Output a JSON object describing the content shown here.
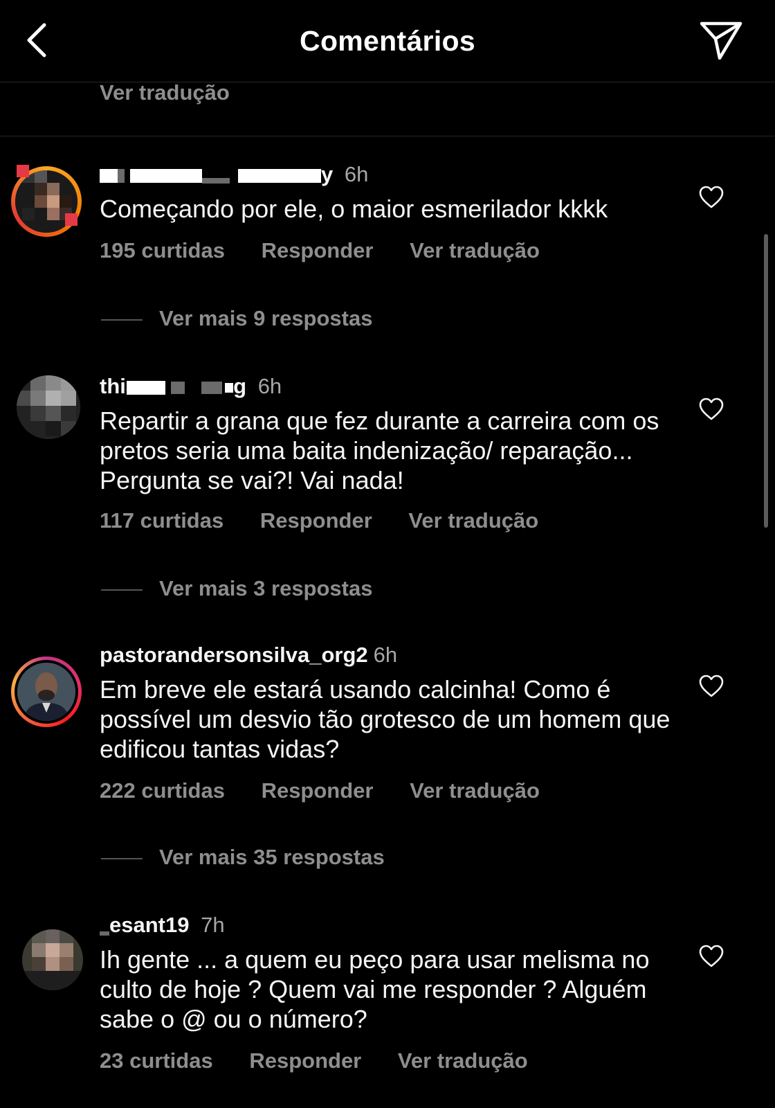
{
  "header": {
    "title": "Comentários",
    "back_icon": "chevron-left-icon",
    "share_icon": "send-icon"
  },
  "top_translate": "Ver tradução",
  "comments": [
    {
      "username_partial": "y",
      "time": "6h",
      "text": "Começando por ele, o maior esmerilador kkkk",
      "likes": "195 curtidas",
      "reply": "Responder",
      "translate": "Ver tradução",
      "more_replies": "Ver mais 9 respostas"
    },
    {
      "username_partial_start": "thia",
      "username_partial_end": "g",
      "time": "6h",
      "text": "Repartir a grana que fez durante a carreira com os pretos seria uma baita indenização/ reparação... Pergunta se vai?! Vai nada!",
      "likes": "117 curtidas",
      "reply": "Responder",
      "translate": "Ver tradução",
      "more_replies": "Ver mais 3 respostas"
    },
    {
      "username": "pastorandersonsilva_org2",
      "time": "6h",
      "text": "Em breve ele estará usando calcinha! Como é possível um desvio tão grotesco de um homem que edificou tantas vidas?",
      "likes": "222 curtidas",
      "reply": "Responder",
      "translate": "Ver tradução",
      "more_replies": "Ver mais 35 respostas"
    },
    {
      "username_partial": "esant19",
      "time": "7h",
      "text": "Ih gente ... a quem eu peço para usar melisma no culto de hoje ? Quem vai me responder ? Alguém sabe o @ ou o número?",
      "likes": "23 curtidas",
      "reply": "Responder",
      "translate": "Ver tradução"
    }
  ]
}
